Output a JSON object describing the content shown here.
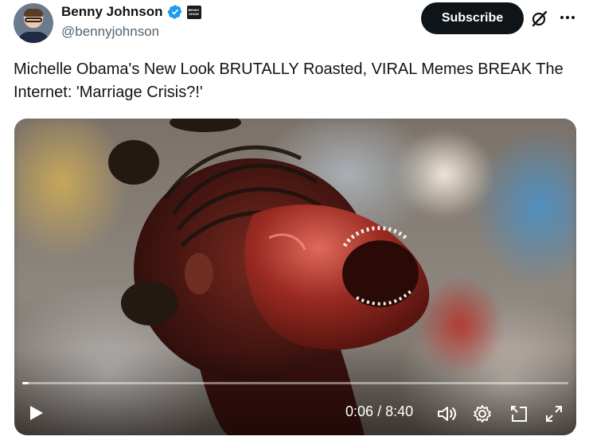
{
  "author": {
    "display_name": "Benny Johnson",
    "handle": "@bennyjohnson",
    "verified": true,
    "affiliate_badge_text": "BENNY SHOW",
    "avatar": "avatar"
  },
  "actions": {
    "subscribe_label": "Subscribe",
    "grok_icon": "grok-icon",
    "more_icon": "more-icon"
  },
  "tweet": {
    "text": "Michelle Obama's New Look BRUTALLY Roasted, VIRAL Memes BREAK The Internet: 'Marriage Crisis?!'"
  },
  "video": {
    "current_time": "0:06",
    "duration": "8:40",
    "time_display": "0:06 / 8:40",
    "progress_fraction": 0.0115,
    "controls": [
      "play-icon",
      "volume-icon",
      "settings-icon",
      "pip-icon",
      "fullscreen-icon"
    ]
  },
  "colors": {
    "text_primary": "#0f1419",
    "text_secondary": "#536471",
    "verified_blue": "#1d9bf0",
    "subscribe_bg": "#0f1419"
  }
}
